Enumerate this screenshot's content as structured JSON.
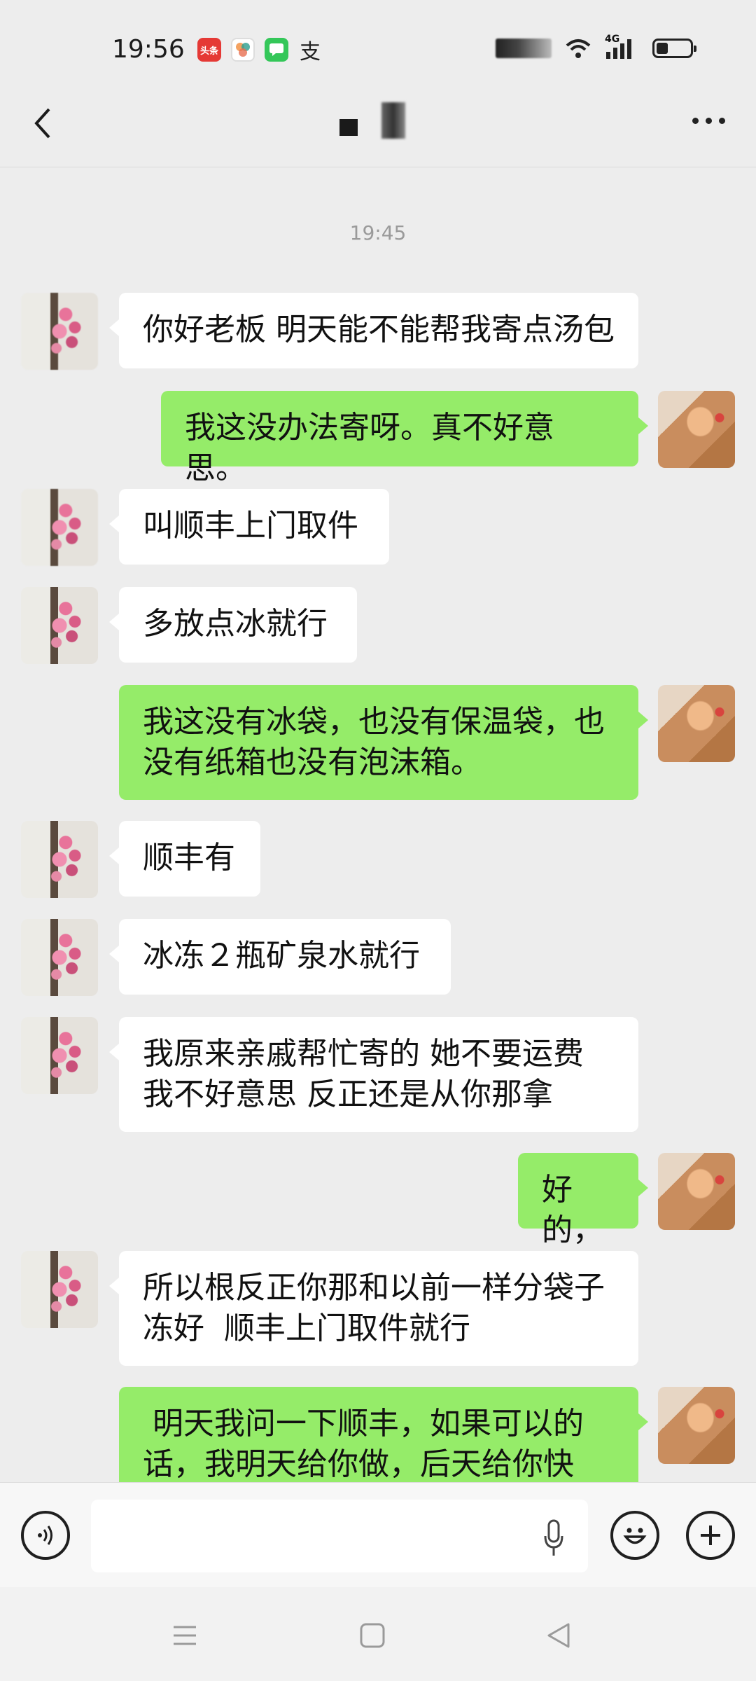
{
  "status_bar": {
    "time": "19:56",
    "apps": [
      {
        "icon": "toutiao-icon",
        "label": "头条",
        "color": "#e53935"
      },
      {
        "icon": "photos-icon",
        "label": "",
        "color": "#f4a261"
      },
      {
        "icon": "messages-icon",
        "label": "",
        "color": "#34c759"
      },
      {
        "icon": "alipay-icon",
        "label": "支",
        "color": "#1677ff"
      }
    ],
    "network": "4G"
  },
  "header": {
    "back_icon": "chevron-left-icon",
    "more_icon": "more-dots-icon"
  },
  "chat": {
    "timestamp": "19:45",
    "messages": [
      {
        "side": "in",
        "text": "你好老板 明天能不能帮我寄点汤包"
      },
      {
        "side": "out",
        "text": "我这没办法寄呀。真不好意思。"
      },
      {
        "side": "in",
        "text": "叫顺丰上门取件"
      },
      {
        "side": "in",
        "text": "多放点冰就行"
      },
      {
        "side": "out",
        "text": "我这没有冰袋，也没有保温袋，也\n没有纸箱也没有泡沫箱。"
      },
      {
        "side": "in",
        "text": "顺丰有"
      },
      {
        "side": "in",
        "text": "冰冻２瓶矿泉水就行"
      },
      {
        "side": "in",
        "text": "我原来亲戚帮忙寄的 她不要运费\n我不好意思 反正还是从你那拿"
      },
      {
        "side": "out",
        "text": "好的，"
      },
      {
        "side": "in",
        "text": "所以根反正你那和以前一样分袋子\n冻好  顺丰上门取件就行"
      },
      {
        "side": "out",
        "text": " 明天我问一下顺丰，如果可以的\n话，我明天给你做，后天给你快"
      }
    ]
  },
  "input_bar": {
    "voice_icon": "voice-icon",
    "text_value": "",
    "mic_icon": "mic-icon",
    "emoji_icon": "emoji-icon",
    "plus_icon": "plus-icon"
  },
  "nav_bar": {
    "menu_icon": "menu-icon",
    "home_icon": "home-square-icon",
    "back_icon": "back-triangle-icon"
  }
}
